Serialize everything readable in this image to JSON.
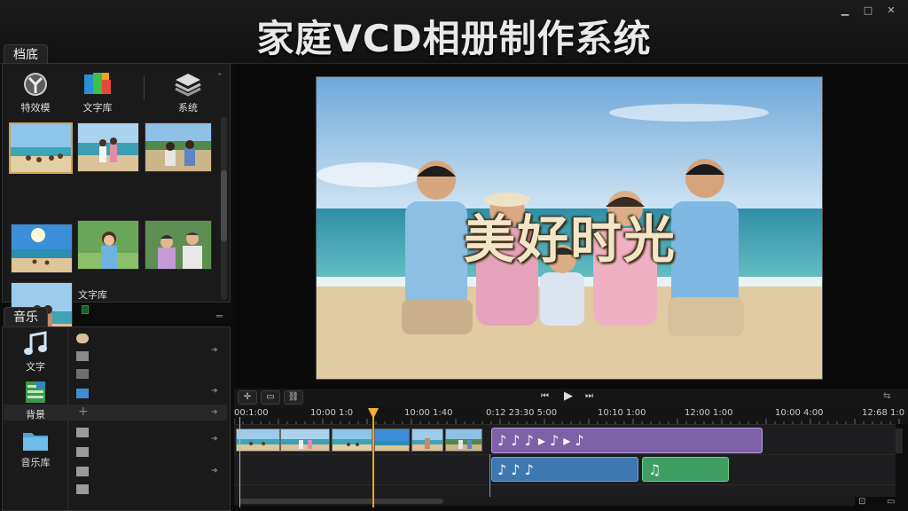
{
  "window": {
    "title": "家庭VCD相册制作系统",
    "minimize": "▁",
    "maximize": "□",
    "close": "✕"
  },
  "left_panel": {
    "tab1": "档底",
    "tools": [
      {
        "label": "特效模",
        "icon": "effects-icon"
      },
      {
        "label": "文字库",
        "icon": "text-library-icon"
      },
      {
        "label": "系统",
        "icon": "system-layers-icon"
      }
    ],
    "library_label": "文字库",
    "tab2": "音乐",
    "music_tools": [
      {
        "label": "文字",
        "icon": "music-note-icon"
      },
      {
        "label": "背景",
        "icon": "background-icon"
      },
      {
        "label": "音乐库",
        "icon": "music-library-folder-icon"
      }
    ]
  },
  "preview": {
    "overlay_text": "美好时光"
  },
  "timeline": {
    "ruler_labels": [
      "00:1:00",
      "10:00 1:0",
      "10:00 1:40",
      "0:12 23:30 5:00",
      "10:10 1:00",
      "12:00 1:00",
      "10:00 4:00",
      "12:68 1:0"
    ]
  },
  "colors": {
    "accent": "#e6a428",
    "audio_purple": "#7e62a8",
    "audio_blue": "#3f78b0",
    "audio_green": "#3f9e62"
  }
}
